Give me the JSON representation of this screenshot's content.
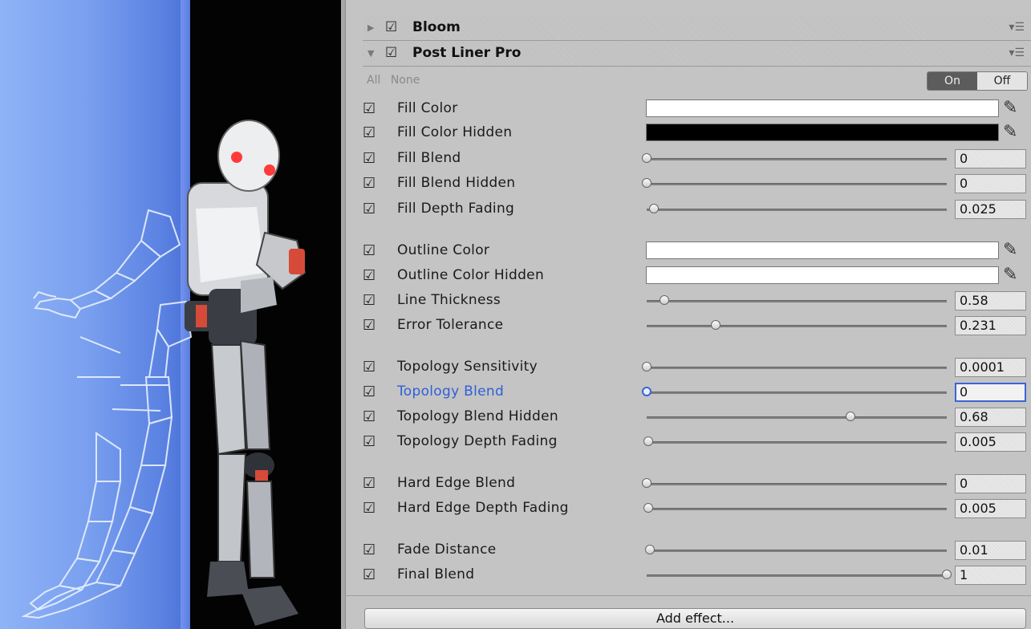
{
  "effects": [
    {
      "title": "Bloom",
      "expanded": false,
      "enabled": true
    },
    {
      "title": "Post Liner Pro",
      "expanded": true,
      "enabled": true
    }
  ],
  "allnone": {
    "all": "All",
    "none": "None"
  },
  "toggle": {
    "on": "On",
    "off": "Off",
    "selected": "On"
  },
  "icons": {
    "check": "☑",
    "collapsed_arrow": "▶",
    "expanded_arrow": "▼",
    "menu": "▾☰",
    "picker": "eyedropper-icon"
  },
  "properties": {
    "fill_color": {
      "label": "Fill Color",
      "color": "#ffffff"
    },
    "fill_color_hidden": {
      "label": "Fill Color Hidden",
      "color": "#000000"
    },
    "fill_blend": {
      "label": "Fill Blend",
      "value": "0",
      "level": 0.0
    },
    "fill_blend_hidden": {
      "label": "Fill Blend Hidden",
      "value": "0",
      "level": 0.0
    },
    "fill_depth_fading": {
      "label": "Fill Depth Fading",
      "value": "0.025",
      "level": 0.025
    },
    "outline_color": {
      "label": "Outline Color",
      "color": "#ffffff"
    },
    "outline_color_hidden": {
      "label": "Outline Color Hidden",
      "color": "#ffffff"
    },
    "line_thickness": {
      "label": "Line Thickness",
      "value": "0.58",
      "level": 0.058
    },
    "error_tolerance": {
      "label": "Error Tolerance",
      "value": "0.231",
      "level": 0.231
    },
    "topology_sensitivity": {
      "label": "Topology Sensitivity",
      "value": "0.0001",
      "level": 0.0
    },
    "topology_blend": {
      "label": "Topology Blend",
      "value": "0",
      "level": 0.0
    },
    "topology_blend_hidden": {
      "label": "Topology Blend Hidden",
      "value": "0.68",
      "level": 0.68
    },
    "topology_depth_fading": {
      "label": "Topology Depth Fading",
      "value": "0.005",
      "level": 0.005
    },
    "hard_edge_blend": {
      "label": "Hard Edge Blend",
      "value": "0",
      "level": 0.0
    },
    "hard_edge_depth_fading": {
      "label": "Hard Edge Depth Fading",
      "value": "0.005",
      "level": 0.005
    },
    "fade_distance": {
      "label": "Fade Distance",
      "value": "0.01",
      "level": 0.01
    },
    "final_blend": {
      "label": "Final Blend",
      "value": "1",
      "level": 1.0
    }
  },
  "add_effect_label": "Add effect...",
  "colors": {
    "focus": "#2f5fd6",
    "viewport_blue": "#7aa0ef"
  }
}
